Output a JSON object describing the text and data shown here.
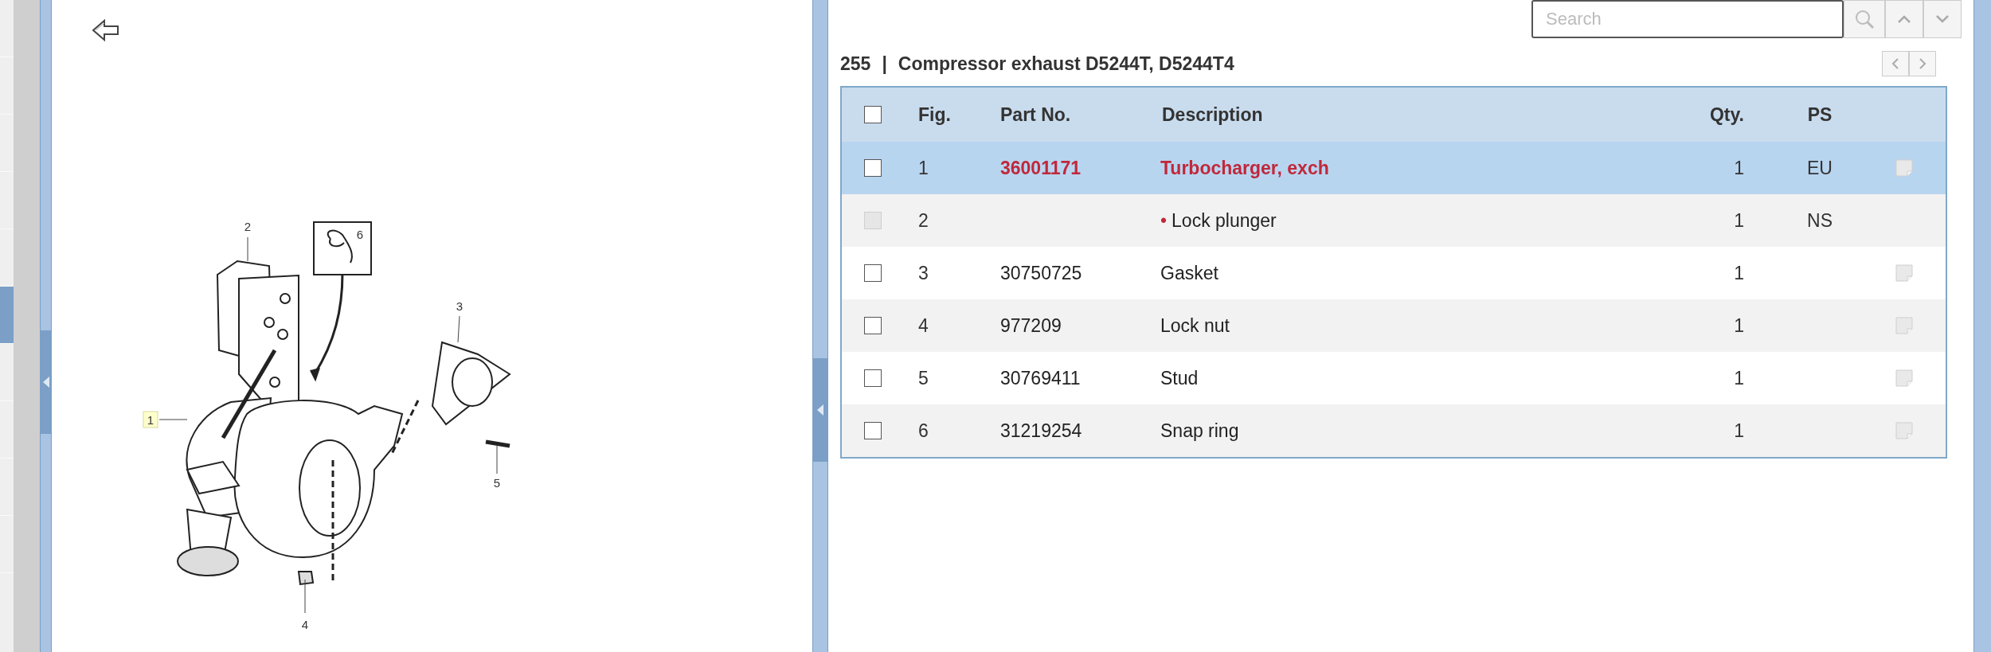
{
  "left_rail": {
    "items": [
      {
        "selected": false
      },
      {
        "selected": false
      },
      {
        "selected": false
      },
      {
        "selected": false
      },
      {
        "selected": false
      },
      {
        "selected": true
      },
      {
        "selected": false
      },
      {
        "selected": false
      },
      {
        "selected": false
      },
      {
        "selected": false
      }
    ]
  },
  "drawing": {
    "callouts": [
      {
        "label": "1",
        "selected": true
      },
      {
        "label": "2",
        "selected": false
      },
      {
        "label": "3",
        "selected": false
      },
      {
        "label": "4",
        "selected": false
      },
      {
        "label": "5",
        "selected": false
      },
      {
        "label": "6",
        "selected": false
      }
    ]
  },
  "search": {
    "placeholder": "Search"
  },
  "title": {
    "number": "255",
    "separator": "|",
    "text": "Compressor exhaust D5244T, D5244T4"
  },
  "table": {
    "select_all": {
      "checked": false
    },
    "columns": [
      "Fig.",
      "Part No.",
      "Description",
      "Qty.",
      "PS"
    ],
    "rows": [
      {
        "fig": "1",
        "part_no": "36001171",
        "description": "Turbocharger, exch",
        "qty": "1",
        "ps": "EU",
        "selected": true,
        "disabled": false,
        "has_note": true
      },
      {
        "fig": "2",
        "marker": "•",
        "description": "Lock plunger",
        "qty": "1",
        "ps": "NS",
        "selected": false,
        "disabled": true,
        "has_note": false
      },
      {
        "fig": "3",
        "part_no": "30750725",
        "description": "Gasket",
        "qty": "1",
        "selected": false,
        "disabled": false,
        "has_note": true
      },
      {
        "fig": "4",
        "part_no": "977209",
        "description": "Lock nut",
        "qty": "1",
        "selected": false,
        "disabled": false,
        "has_note": true
      },
      {
        "fig": "5",
        "part_no": "30769411",
        "description": "Stud",
        "qty": "1",
        "selected": false,
        "disabled": false,
        "has_note": true
      },
      {
        "fig": "6",
        "part_no": "31219254",
        "description": "Snap ring",
        "qty": "1",
        "selected": false,
        "disabled": false,
        "has_note": true
      }
    ]
  }
}
